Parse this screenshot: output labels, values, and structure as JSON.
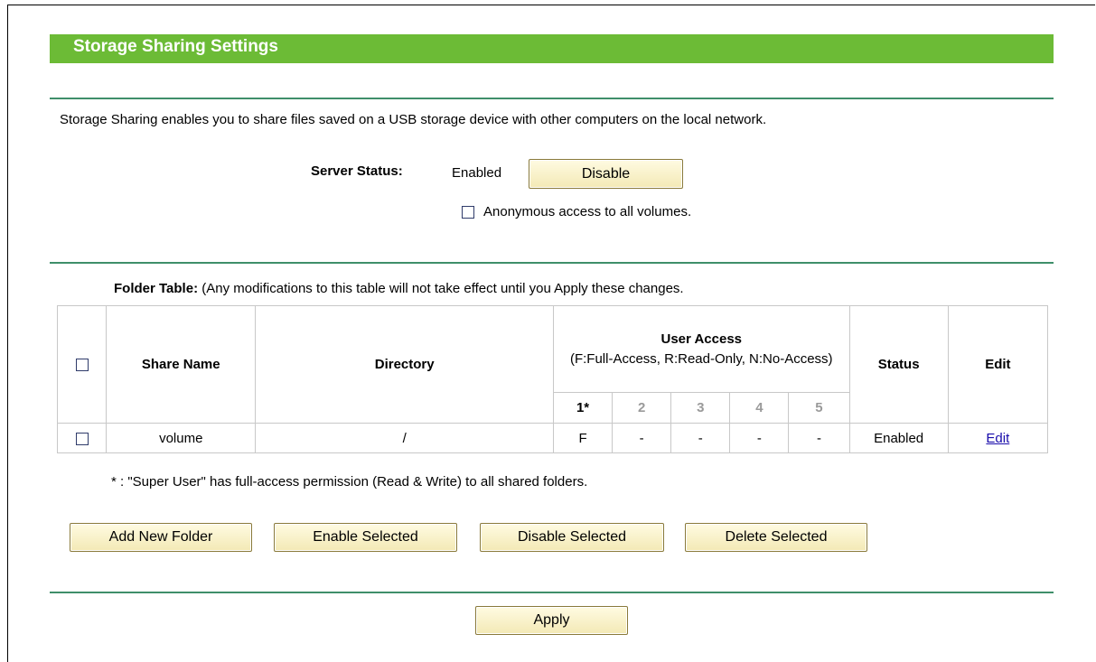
{
  "page": {
    "title": "Storage Sharing Settings",
    "description": "Storage Sharing enables you to share files saved on a USB storage device with other computers on the local network."
  },
  "server": {
    "label": "Server Status:",
    "value": "Enabled",
    "toggle_button": "Disable",
    "anonymous_label": "Anonymous access to all volumes.",
    "anonymous_checked": false
  },
  "folder_table": {
    "label": "Folder Table:",
    "note": "(Any modifications to this table will not take effect until you Apply these changes.",
    "headers": {
      "share_name": "Share Name",
      "directory": "Directory",
      "user_access": "User Access",
      "user_access_legend": "(F:Full-Access, R:Read-Only, N:No-Access)",
      "status": "Status",
      "edit": "Edit"
    },
    "user_columns": [
      "1*",
      "2",
      "3",
      "4",
      "5"
    ],
    "rows": [
      {
        "share_name": "volume",
        "directory": "/",
        "access": [
          "F",
          "-",
          "-",
          "-",
          "-"
        ],
        "status": "Enabled",
        "edit": "Edit"
      }
    ],
    "footnote": "* : \"Super User\" has full-access permission (Read & Write) to all shared folders."
  },
  "actions": {
    "add_new_folder": "Add New Folder",
    "enable_selected": "Enable Selected",
    "disable_selected": "Disable Selected",
    "delete_selected": "Delete Selected",
    "apply": "Apply"
  },
  "colors": {
    "title_bar": "#6cbb36",
    "divider": "#3f8f6a",
    "link": "#1a0dab"
  }
}
